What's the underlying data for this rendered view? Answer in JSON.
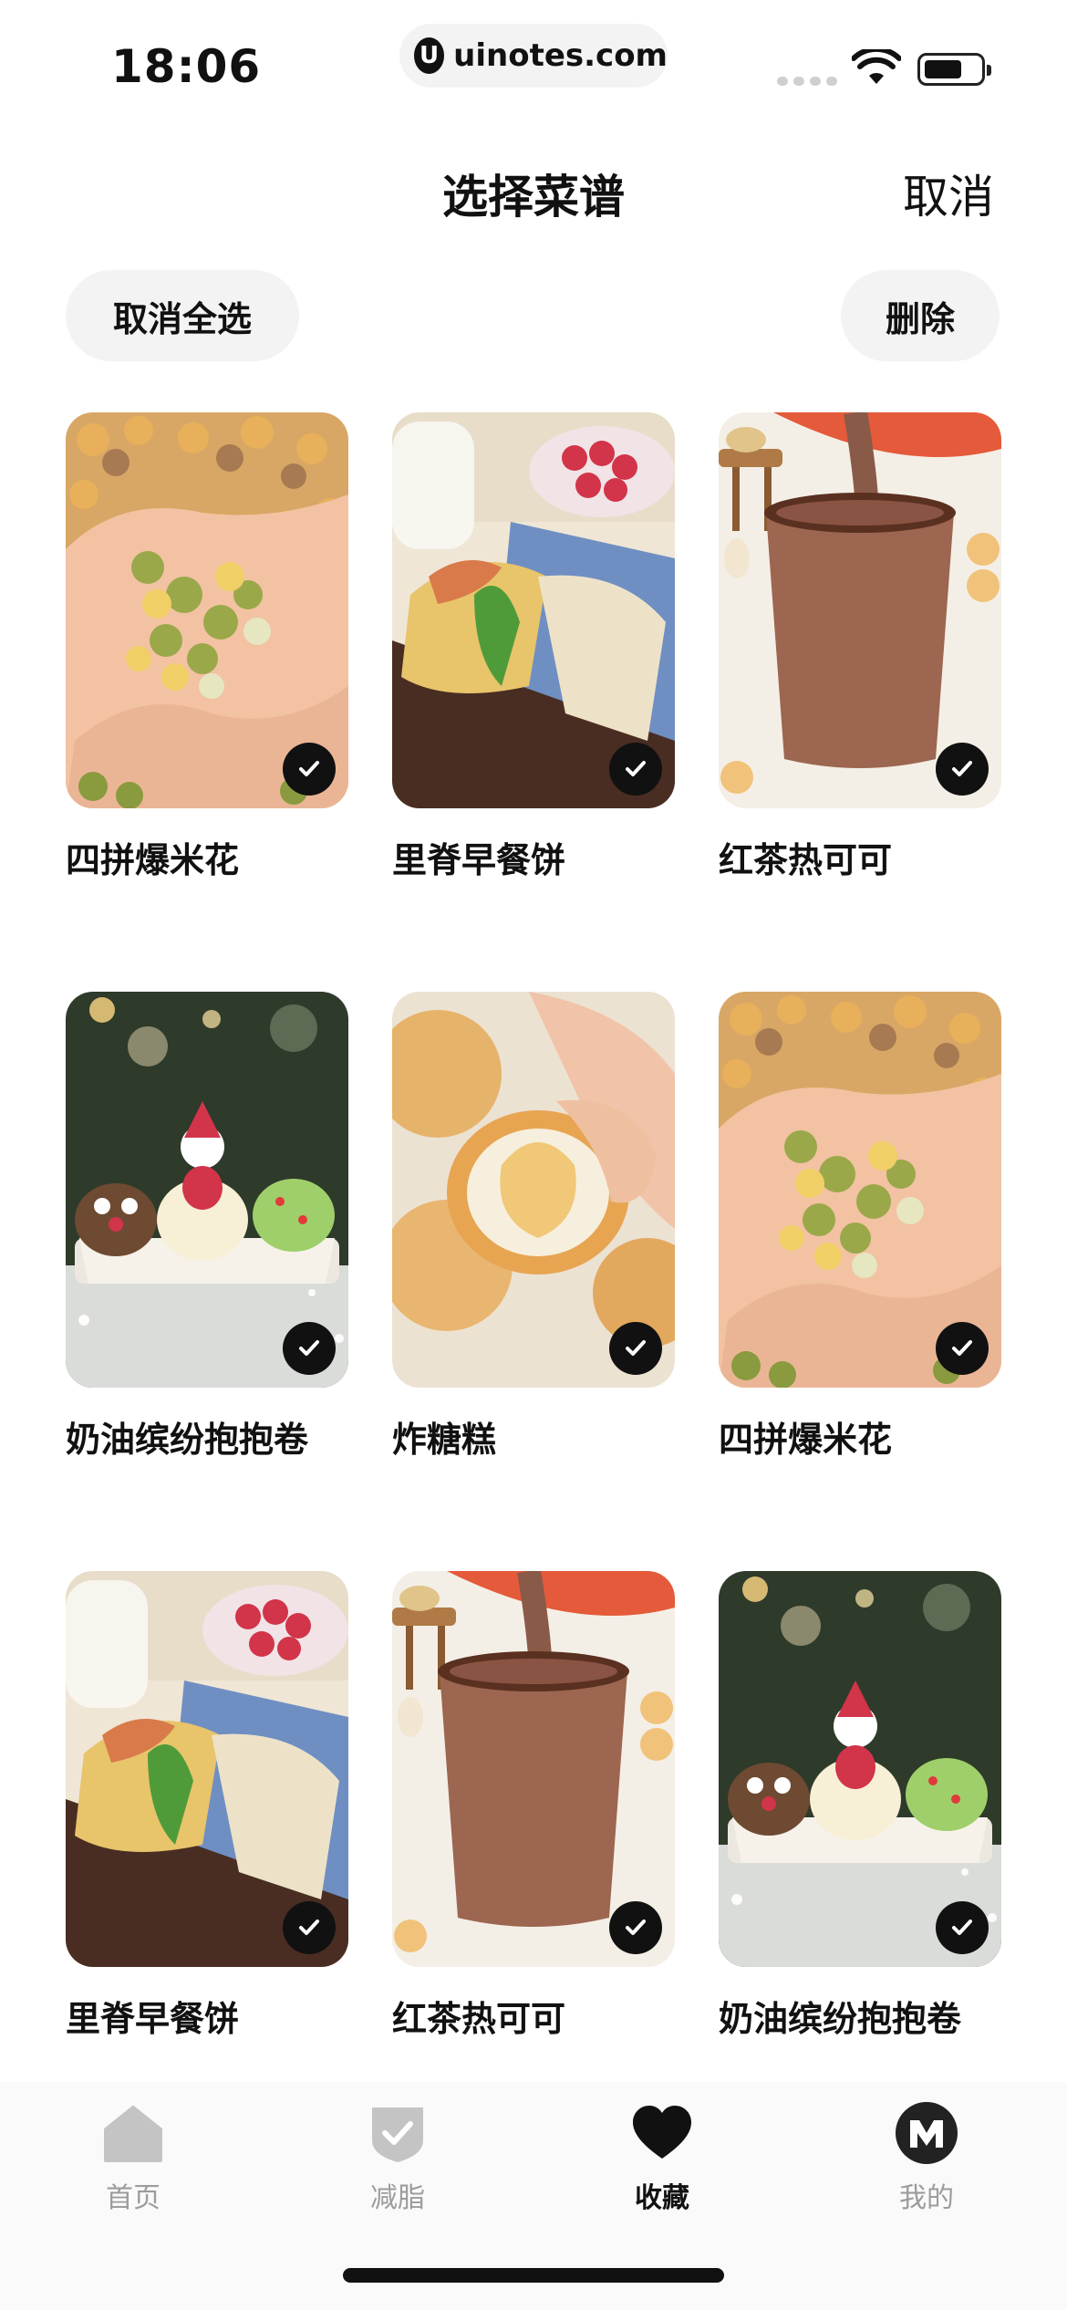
{
  "status_bar": {
    "time": "18:06",
    "url": "uinotes.com",
    "url_logo_letter": "U"
  },
  "header": {
    "title": "选择菜谱",
    "cancel_label": "取消"
  },
  "actions": {
    "deselect_all_label": "取消全选",
    "delete_label": "删除"
  },
  "recipes": [
    {
      "title": "四拼爆米花",
      "image": "popcorn-in-hands",
      "selected": true
    },
    {
      "title": "里脊早餐饼",
      "image": "breakfast-pancake-board",
      "selected": true
    },
    {
      "title": "红茶热可可",
      "image": "hot-cocoa-pour",
      "selected": true
    },
    {
      "title": "奶油缤纷抱抱卷",
      "image": "christmas-cream-rolls",
      "selected": true
    },
    {
      "title": "炸糖糕",
      "image": "fried-sugar-cake",
      "selected": true
    },
    {
      "title": "四拼爆米花",
      "image": "popcorn-in-hands",
      "selected": true
    },
    {
      "title": "里脊早餐饼",
      "image": "breakfast-pancake-board",
      "selected": true
    },
    {
      "title": "红茶热可可",
      "image": "hot-cocoa-pour",
      "selected": true
    },
    {
      "title": "奶油缤纷抱抱卷",
      "image": "christmas-cream-rolls",
      "selected": true
    }
  ],
  "tab_bar": {
    "tabs": [
      {
        "label": "首页",
        "icon": "home-icon",
        "active": false
      },
      {
        "label": "减脂",
        "icon": "shield-check-icon",
        "active": false
      },
      {
        "label": "收藏",
        "icon": "heart-icon",
        "active": true
      },
      {
        "label": "我的",
        "icon": "profile-m-icon",
        "active": false
      }
    ]
  },
  "colors": {
    "accent": "#111111",
    "pill_bg": "#f3f3f3",
    "inactive_tab": "#9c9c9c"
  }
}
